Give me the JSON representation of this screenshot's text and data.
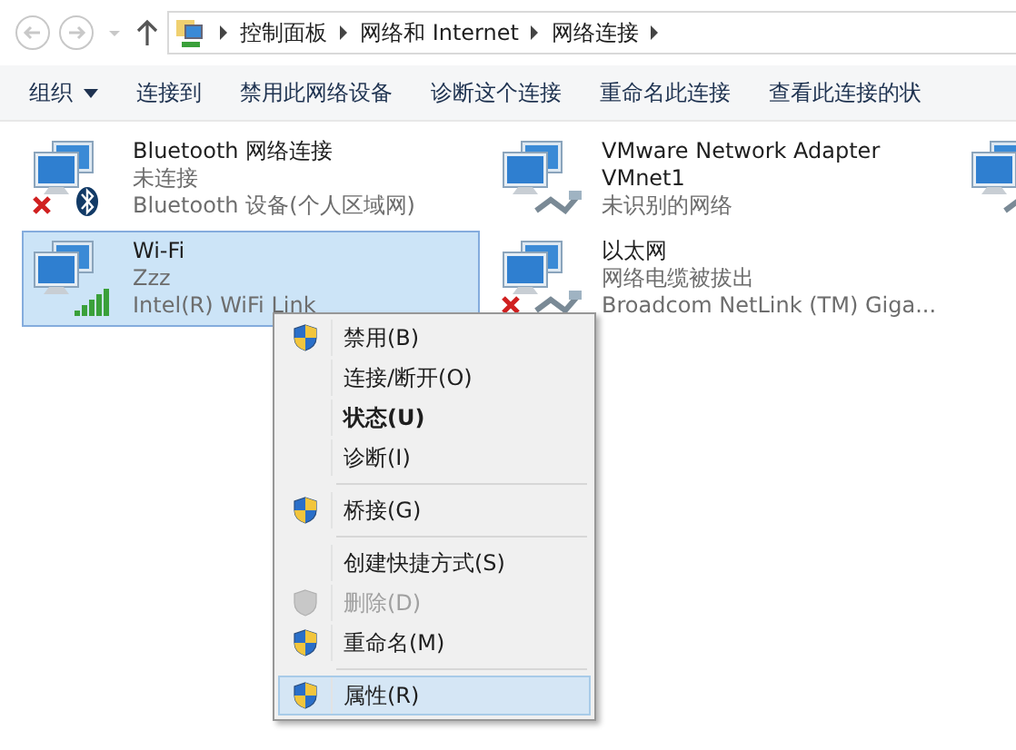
{
  "address_bar": {
    "breadcrumbs": [
      "控制面板",
      "网络和 Internet",
      "网络连接"
    ]
  },
  "toolbar": [
    {
      "label": "组织",
      "kind": "menu"
    },
    {
      "label": "连接到",
      "kind": "button"
    },
    {
      "label": "禁用此网络设备",
      "kind": "button"
    },
    {
      "label": "诊断这个连接",
      "kind": "button"
    },
    {
      "label": "重命名此连接",
      "kind": "button"
    },
    {
      "label": "查看此连接的状",
      "kind": "button"
    }
  ],
  "adapters": [
    {
      "name": "Bluetooth 网络连接",
      "status": "未连接",
      "device": "Bluetooth 设备(个人区域网)",
      "disconnected": true,
      "bluetooth": true,
      "signal": false,
      "cable": false,
      "selected": false
    },
    {
      "name": "VMware Network Adapter VMnet1",
      "status": "未识别的网络",
      "disconnected": false,
      "bluetooth": false,
      "signal": false,
      "cable": true,
      "selected": false
    },
    {
      "disconnected": false,
      "bluetooth": false,
      "signal": false,
      "cable": true,
      "selected": false
    },
    {
      "name": "Wi-Fi",
      "status": "Zzz",
      "device": "Intel(R) WiFi Link",
      "disconnected": false,
      "bluetooth": false,
      "signal": true,
      "cable": false,
      "selected": true
    },
    {
      "name": "以太网",
      "status": "网络电缆被拔出",
      "device": "Broadcom NetLink (TM) Giga...",
      "disconnected": true,
      "bluetooth": false,
      "signal": false,
      "cable": true,
      "selected": false
    }
  ],
  "context_menu": [
    {
      "kind": "item",
      "label": "禁用(B)",
      "shield": true,
      "bold": false,
      "disabled": false,
      "selected": false
    },
    {
      "kind": "item",
      "label": "连接/断开(O)",
      "shield": false,
      "bold": false,
      "disabled": false,
      "selected": false
    },
    {
      "kind": "item",
      "label": "状态(U)",
      "shield": false,
      "bold": true,
      "disabled": false,
      "selected": false
    },
    {
      "kind": "item",
      "label": "诊断(I)",
      "shield": false,
      "bold": false,
      "disabled": false,
      "selected": false
    },
    {
      "kind": "separator"
    },
    {
      "kind": "item",
      "label": "桥接(G)",
      "shield": true,
      "bold": false,
      "disabled": false,
      "selected": false
    },
    {
      "kind": "separator"
    },
    {
      "kind": "item",
      "label": "创建快捷方式(S)",
      "shield": false,
      "bold": false,
      "disabled": false,
      "selected": false
    },
    {
      "kind": "item",
      "label": "删除(D)",
      "shield": true,
      "bold": false,
      "disabled": true,
      "selected": false
    },
    {
      "kind": "item",
      "label": "重命名(M)",
      "shield": true,
      "bold": false,
      "disabled": false,
      "selected": false
    },
    {
      "kind": "separator"
    },
    {
      "kind": "item",
      "label": "属性(R)",
      "shield": true,
      "bold": false,
      "disabled": false,
      "selected": true
    }
  ]
}
